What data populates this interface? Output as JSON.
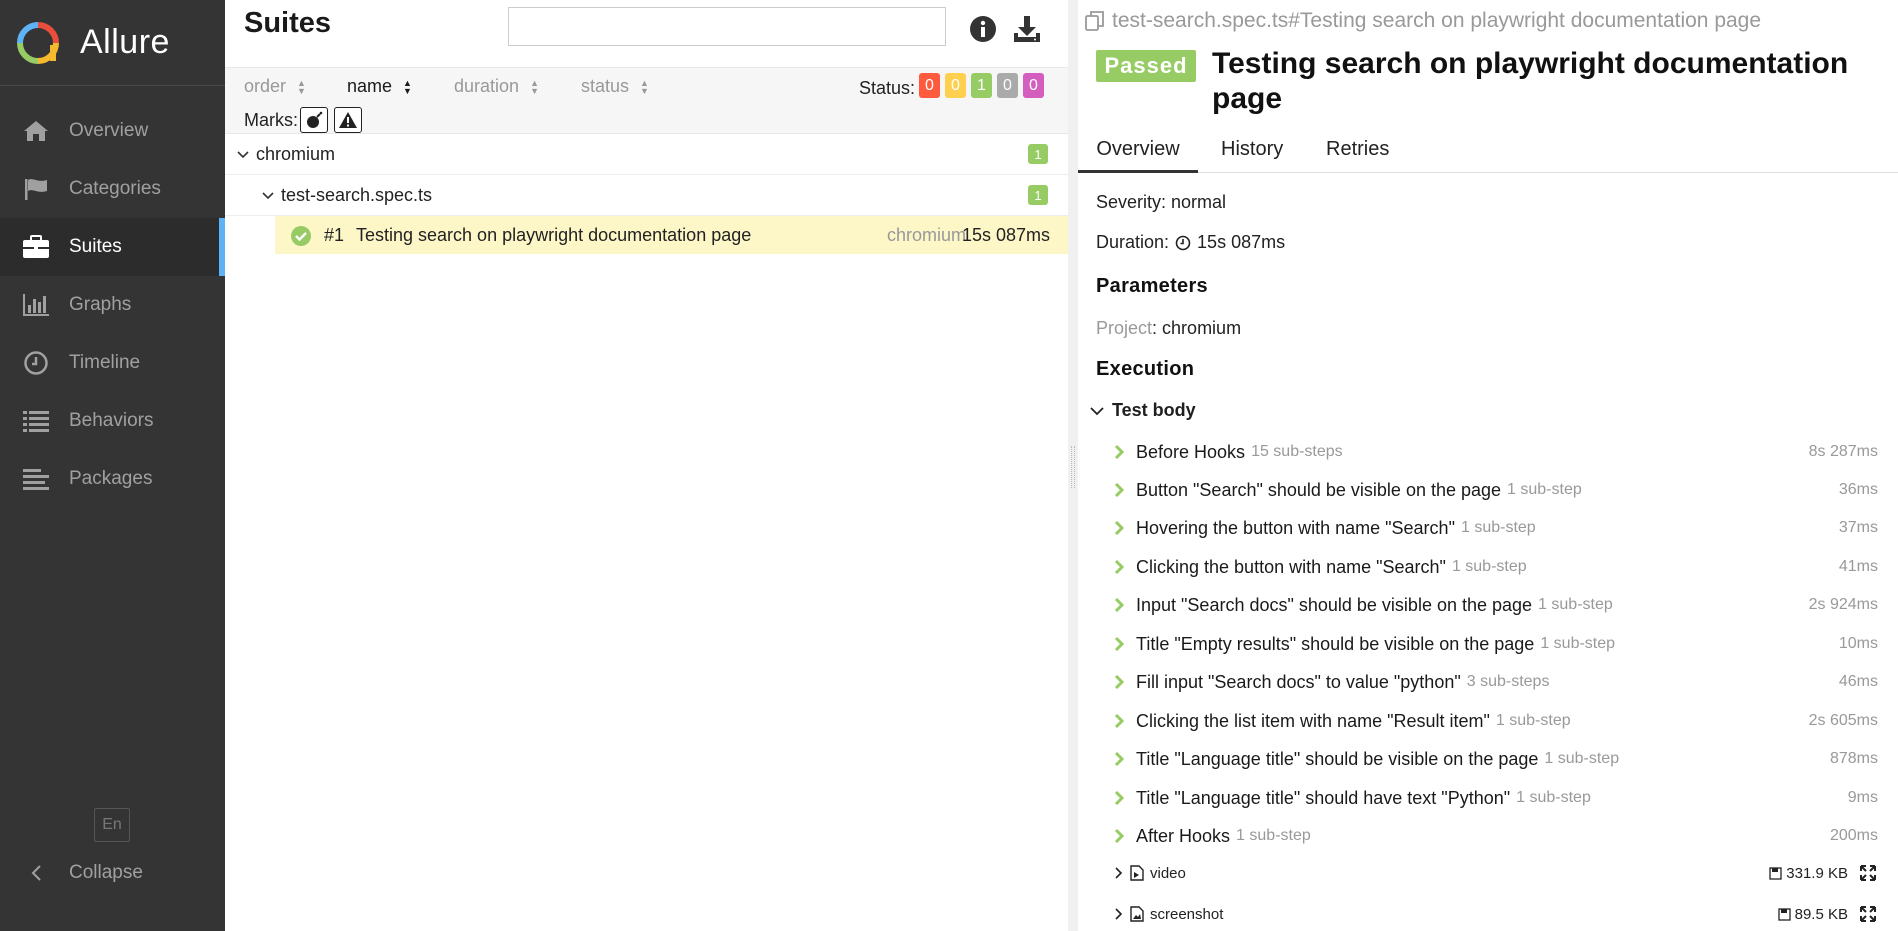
{
  "app": {
    "brand": "Allure"
  },
  "sidebar": {
    "items": [
      {
        "label": "Overview",
        "icon": "home-icon"
      },
      {
        "label": "Categories",
        "icon": "flag-icon"
      },
      {
        "label": "Suites",
        "icon": "briefcase-icon",
        "active": true
      },
      {
        "label": "Graphs",
        "icon": "bar-chart-icon"
      },
      {
        "label": "Timeline",
        "icon": "clock-icon"
      },
      {
        "label": "Behaviors",
        "icon": "list-icon"
      },
      {
        "label": "Packages",
        "icon": "align-left-icon"
      }
    ],
    "language": "En",
    "collapse_label": "Collapse"
  },
  "suites": {
    "title": "Suites",
    "search_placeholder": "",
    "sort": {
      "order": "order",
      "name": "name",
      "duration": "duration",
      "status": "status"
    },
    "status_label": "Status:",
    "status_counts": [
      {
        "value": "0",
        "color": "#fd5a3e"
      },
      {
        "value": "0",
        "color": "#ffd050"
      },
      {
        "value": "1",
        "color": "#97cc64"
      },
      {
        "value": "0",
        "color": "#aaaaaa"
      },
      {
        "value": "0",
        "color": "#d35ebe"
      }
    ],
    "marks_label": "Marks:",
    "tree": {
      "group": {
        "label": "chromium",
        "count": "1"
      },
      "file": {
        "label": "test-search.spec.ts",
        "count": "1"
      },
      "test": {
        "num": "#1",
        "name": "Testing search on playwright documentation page",
        "project": "chromium",
        "duration": "15s 087ms"
      }
    }
  },
  "detail": {
    "breadcrumb": "test-search.spec.ts#Testing search on playwright documentation page",
    "status": "Passed",
    "title": "Testing search on playwright documentation page",
    "tabs": [
      "Overview",
      "History",
      "Retries"
    ],
    "severity_label": "Severity:",
    "severity": "normal",
    "duration_label": "Duration:",
    "duration": "15s 087ms",
    "parameters_heading": "Parameters",
    "param_name": "Project",
    "param_value": "chromium",
    "execution_heading": "Execution",
    "test_body_label": "Test body",
    "steps": [
      {
        "name": "Before Hooks",
        "sub": "15 sub-steps",
        "duration": "8s 287ms"
      },
      {
        "name": "Button \"Search\" should be visible on the page",
        "sub": "1 sub-step",
        "duration": "36ms"
      },
      {
        "name": "Hovering the button with name \"Search\"",
        "sub": "1 sub-step",
        "duration": "37ms"
      },
      {
        "name": "Clicking the button with name \"Search\"",
        "sub": "1 sub-step",
        "duration": "41ms"
      },
      {
        "name": "Input \"Search docs\" should be visible on the page",
        "sub": "1 sub-step",
        "duration": "2s 924ms"
      },
      {
        "name": "Title \"Empty results\" should be visible on the page",
        "sub": "1 sub-step",
        "duration": "10ms"
      },
      {
        "name": "Fill input \"Search docs\" to value \"python\"",
        "sub": "3 sub-steps",
        "duration": "46ms"
      },
      {
        "name": "Clicking the list item with name \"Result item\"",
        "sub": "1 sub-step",
        "duration": "2s 605ms"
      },
      {
        "name": "Title \"Language title\" should be visible on the page",
        "sub": "1 sub-step",
        "duration": "878ms"
      },
      {
        "name": "Title \"Language title\" should have text \"Python\"",
        "sub": "1 sub-step",
        "duration": "9ms"
      },
      {
        "name": "After Hooks",
        "sub": "1 sub-step",
        "duration": "200ms"
      }
    ],
    "attachments": [
      {
        "name": "video",
        "size": "331.9 KB"
      },
      {
        "name": "screenshot",
        "size": "89.5 KB"
      }
    ]
  }
}
